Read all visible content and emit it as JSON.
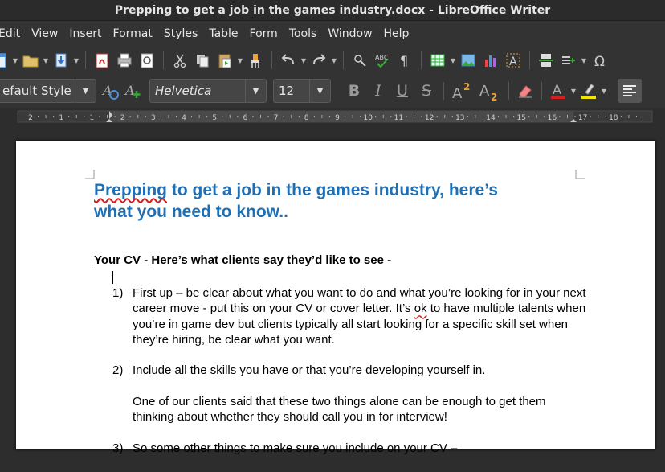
{
  "window": {
    "title": "Prepping to get a job in the games industry.docx - LibreOffice Writer"
  },
  "menu": [
    "Edit",
    "View",
    "Insert",
    "Format",
    "Styles",
    "Table",
    "Form",
    "Tools",
    "Window",
    "Help"
  ],
  "format_bar": {
    "paragraph_style": "efault Style",
    "font_name": "Helvetica",
    "font_size": "12"
  },
  "ruler": {
    "ticks": [
      "2",
      "1",
      "1",
      "2",
      "3",
      "4",
      "5",
      "6",
      "7",
      "8",
      "9",
      "10",
      "11",
      "12",
      "13",
      "14",
      "15",
      "16",
      "17",
      "18"
    ]
  },
  "document": {
    "title_line1": "Prepping to get a job in the games industry, here’s",
    "title_line1_rest": " to get a job in the games industry, here’s",
    "title_word1": "Prepping",
    "title_line2": "what you need to know..",
    "section_heading_u": "Your CV - ",
    "section_heading_rest": "Here’s what clients say they’d like to see",
    "section_heading_tail": " -",
    "items": [
      {
        "num": "1)",
        "paragraphs": [
          "First up – be clear about what you want to do and what you’re looking for in your next career move - put this on your CV or cover letter. It’s ok to have multiple talents when you’re in game dev but clients typically all start looking for a specific skill set when they’re hiring, be clear what you want."
        ]
      },
      {
        "num": "2)",
        "paragraphs": [
          "Include all the skills you have or that you’re developing yourself in.",
          "One of our clients said that these two things alone can be enough to get them thinking about whether they should call you in for interview!"
        ]
      },
      {
        "num": "3)",
        "paragraphs": [
          "So some other things to make sure you include on your CV –"
        ]
      }
    ]
  },
  "colors": {
    "heading": "#1f6fb5",
    "spell": "#d02020",
    "chrome": "#333333"
  }
}
